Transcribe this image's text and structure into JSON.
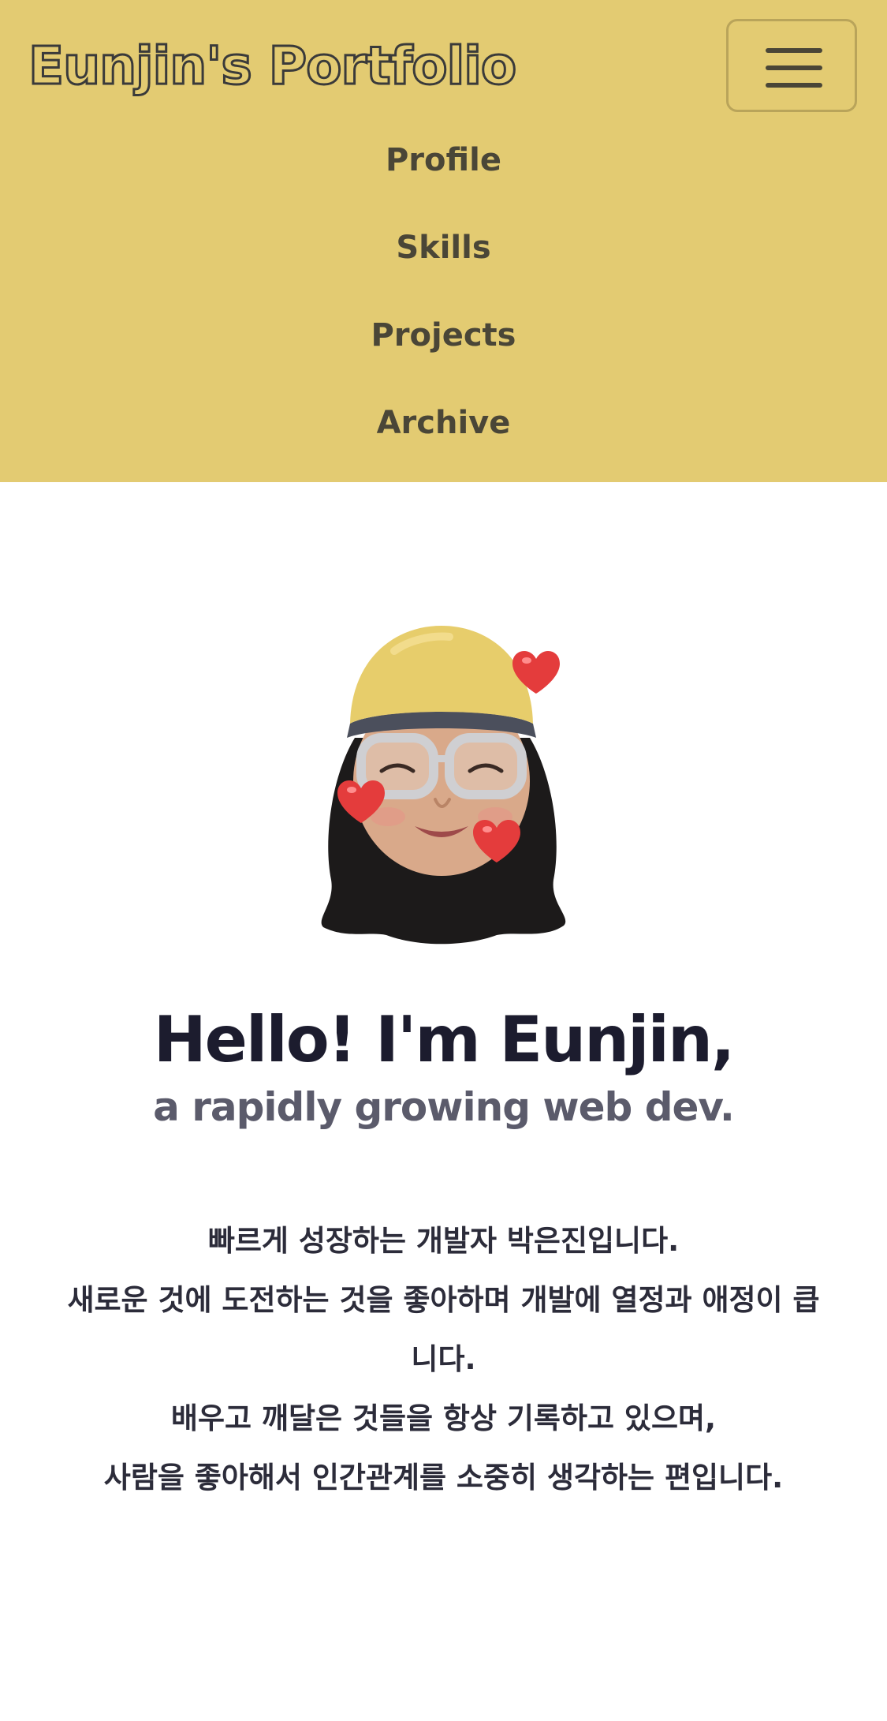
{
  "navbar": {
    "brand": "Eunjin's Portfolio",
    "toggle_icon": "hamburger-menu-icon",
    "bg_color": "#e3cb72",
    "items": [
      {
        "label": "Profile"
      },
      {
        "label": "Skills"
      },
      {
        "label": "Projects"
      },
      {
        "label": "Archive"
      }
    ]
  },
  "hero": {
    "avatar_icon": "memoji-avatar-with-hearts",
    "greeting": "Hello! I'm Eunjin,",
    "tagline": "a rapidly growing web dev.",
    "intro_lines": [
      "빠르게 성장하는 개발자 박은진입니다.",
      "새로운 것에 도전하는 것을 좋아하며 개발에 열정과 애정이 큽니다.",
      "배우고 깨달은 것들을 항상 기록하고 있으며,",
      "사람을 좋아해서 인간관계를 소중히 생각하는 편입니다."
    ]
  }
}
